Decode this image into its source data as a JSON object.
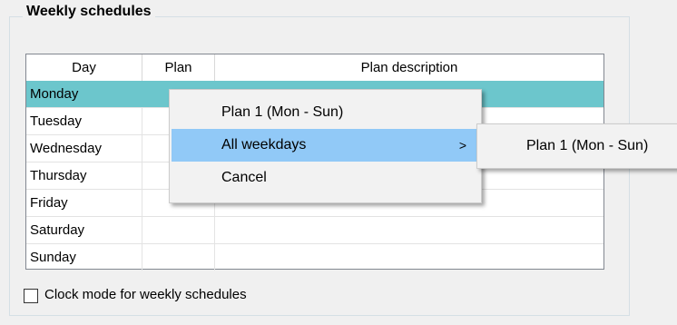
{
  "group": {
    "title": "Weekly schedules"
  },
  "grid": {
    "columns": [
      "Day",
      "Plan",
      "Plan description"
    ],
    "rows": [
      {
        "day": "Monday",
        "plan": "",
        "description": "",
        "selected": true
      },
      {
        "day": "Tuesday",
        "plan": "",
        "description": ""
      },
      {
        "day": "Wednesday",
        "plan": "",
        "description": ""
      },
      {
        "day": "Thursday",
        "plan": "",
        "description": ""
      },
      {
        "day": "Friday",
        "plan": "",
        "description": ""
      },
      {
        "day": "Saturday",
        "plan": "",
        "description": ""
      },
      {
        "day": "Sunday",
        "plan": "",
        "description": ""
      }
    ]
  },
  "checkbox": {
    "label": "Clock mode for weekly schedules",
    "checked": false
  },
  "context_menu": {
    "items": [
      {
        "label": "Plan 1 (Mon - Sun)"
      },
      {
        "label": "All weekdays",
        "arrow": ">",
        "highlighted": true
      },
      {
        "label": "Cancel"
      }
    ],
    "submenu": {
      "items": [
        {
          "label": "Plan 1 (Mon - Sun)"
        }
      ]
    }
  },
  "colors": {
    "selected_row": "#6cc6cc",
    "menu_highlight": "#91c9f7"
  }
}
